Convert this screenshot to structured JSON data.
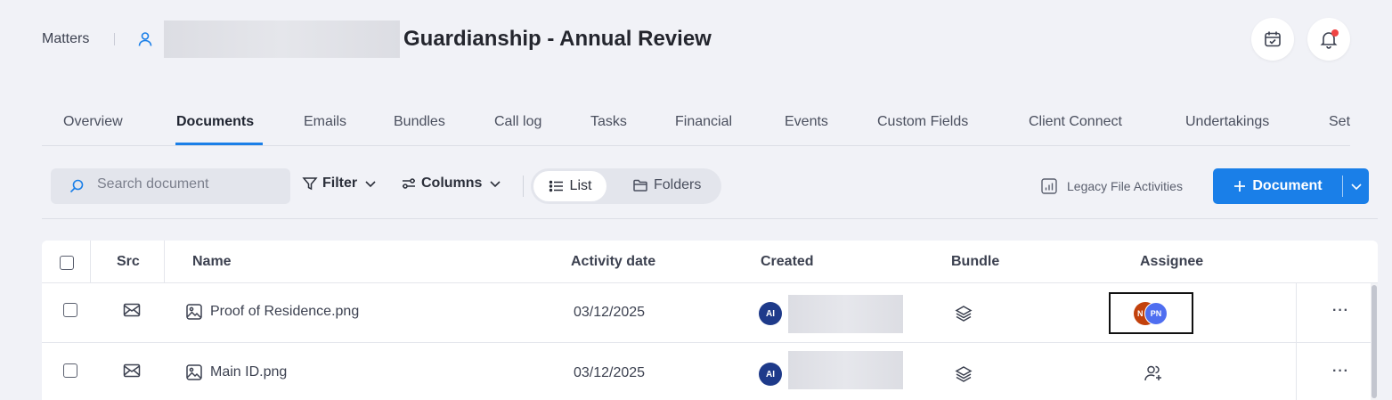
{
  "header": {
    "breadcrumb": "Matters",
    "title": "Guardianship - Annual Review"
  },
  "tabs": [
    "Overview",
    "Documents",
    "Emails",
    "Bundles",
    "Call log",
    "Tasks",
    "Financial",
    "Events",
    "Custom Fields",
    "Client Connect",
    "Undertakings",
    "Set"
  ],
  "active_tab": "Documents",
  "toolbar": {
    "search_placeholder": "Search document",
    "filter_label": "Filter",
    "columns_label": "Columns",
    "list_label": "List",
    "folders_label": "Folders",
    "legacy_label": "Legacy File Activities",
    "document_button": "Document"
  },
  "table": {
    "headers": {
      "src": "Src",
      "name": "Name",
      "activity_date": "Activity date",
      "created": "Created",
      "bundle": "Bundle",
      "assignee": "Assignee"
    },
    "rows": [
      {
        "name": "Proof of Residence.png",
        "activity_date": "03/12/2025",
        "created_initials": "AI",
        "assignees": [
          "N",
          "PN"
        ],
        "more": "···"
      },
      {
        "name": "Main ID.png",
        "activity_date": "03/12/2025",
        "created_initials": "AI",
        "assignees": [],
        "more": "···"
      }
    ]
  },
  "colors": {
    "accent": "#1a7fe8",
    "background": "#f1f2f7",
    "avatar_ai": "#1e3a8a",
    "avatar_orange": "#c2410c",
    "avatar_pn": "#4f6ef0",
    "notification_dot": "#ef4444"
  }
}
